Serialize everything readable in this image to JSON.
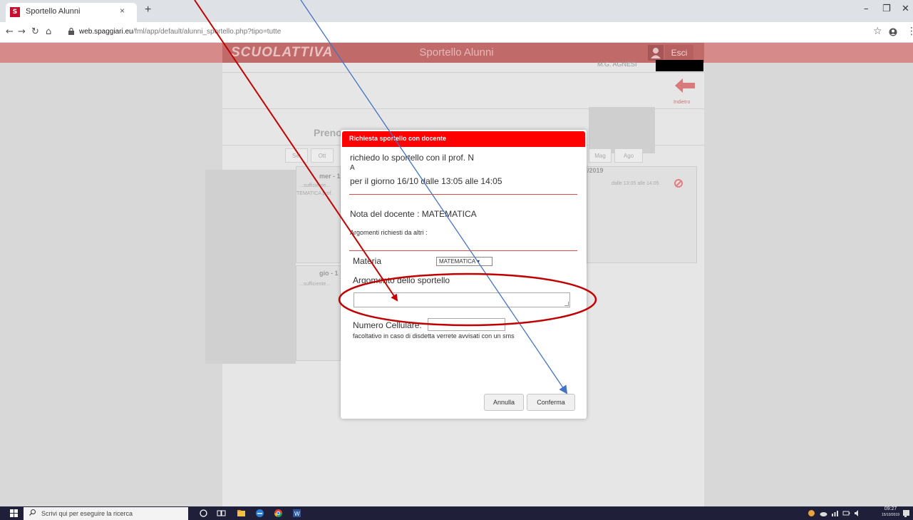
{
  "browser": {
    "tab_title": "Sportello Alunni",
    "tab_close": "×",
    "new_tab": "+",
    "url_host": "web.spaggiari.eu",
    "url_path": "/fml/app/default/alunni_sportello.php?tipo=tutte",
    "minimize": "–",
    "maximize": "❐",
    "close": "✕"
  },
  "site": {
    "logo": "SCUOLATTIVA",
    "title": "Sportello Alunni",
    "logout_label": "Esci",
    "user_name": "M.G. AGNESI",
    "back_label": "Indietro",
    "page_title": "Preno",
    "period": "/2019",
    "week_buttons": [
      "Set",
      "Ott",
      "Mag",
      "Ago"
    ],
    "slot_1_header": "mer - 1",
    "slot_1_line1": "...sufficiente...",
    "slot_1_line2": "TEMATICA prof.",
    "slot_1_right": "dalle 13:05 alle 14:05",
    "slot_2_header": "gio - 1",
    "slot_2_line1": "...sufficiente..."
  },
  "modal": {
    "title": "Richiesta sportello con docente",
    "line1": "richiedo lo sportello con il prof. N",
    "line1b": "A",
    "line2": "per il giorno 16/10 dalle 13:05 alle 14:05",
    "nota": "Nota del docente : MATEMATICA",
    "argomenti_altri": "Argomenti richiesti da altri :",
    "materia_label": "Materia",
    "materia_value": "MATEMATICA ▾",
    "argomento_label": "Argomento dello sportello",
    "cell_label": "Numero Cellulare:",
    "cell_hint": "facoltativo in caso di disdetta verrete avvisati con un sms",
    "cancel_label": "Annulla",
    "confirm_label": "Conferma"
  },
  "annotation": {
    "red": "#c00000",
    "blue": "#4472c4"
  },
  "taskbar": {
    "search_placeholder": "Scrivi qui per eseguire la ricerca",
    "time": "09:27",
    "date": "15/10/2019"
  },
  "colors": {
    "modal_header": "#ff0000",
    "site_header": "#c06a6a"
  }
}
